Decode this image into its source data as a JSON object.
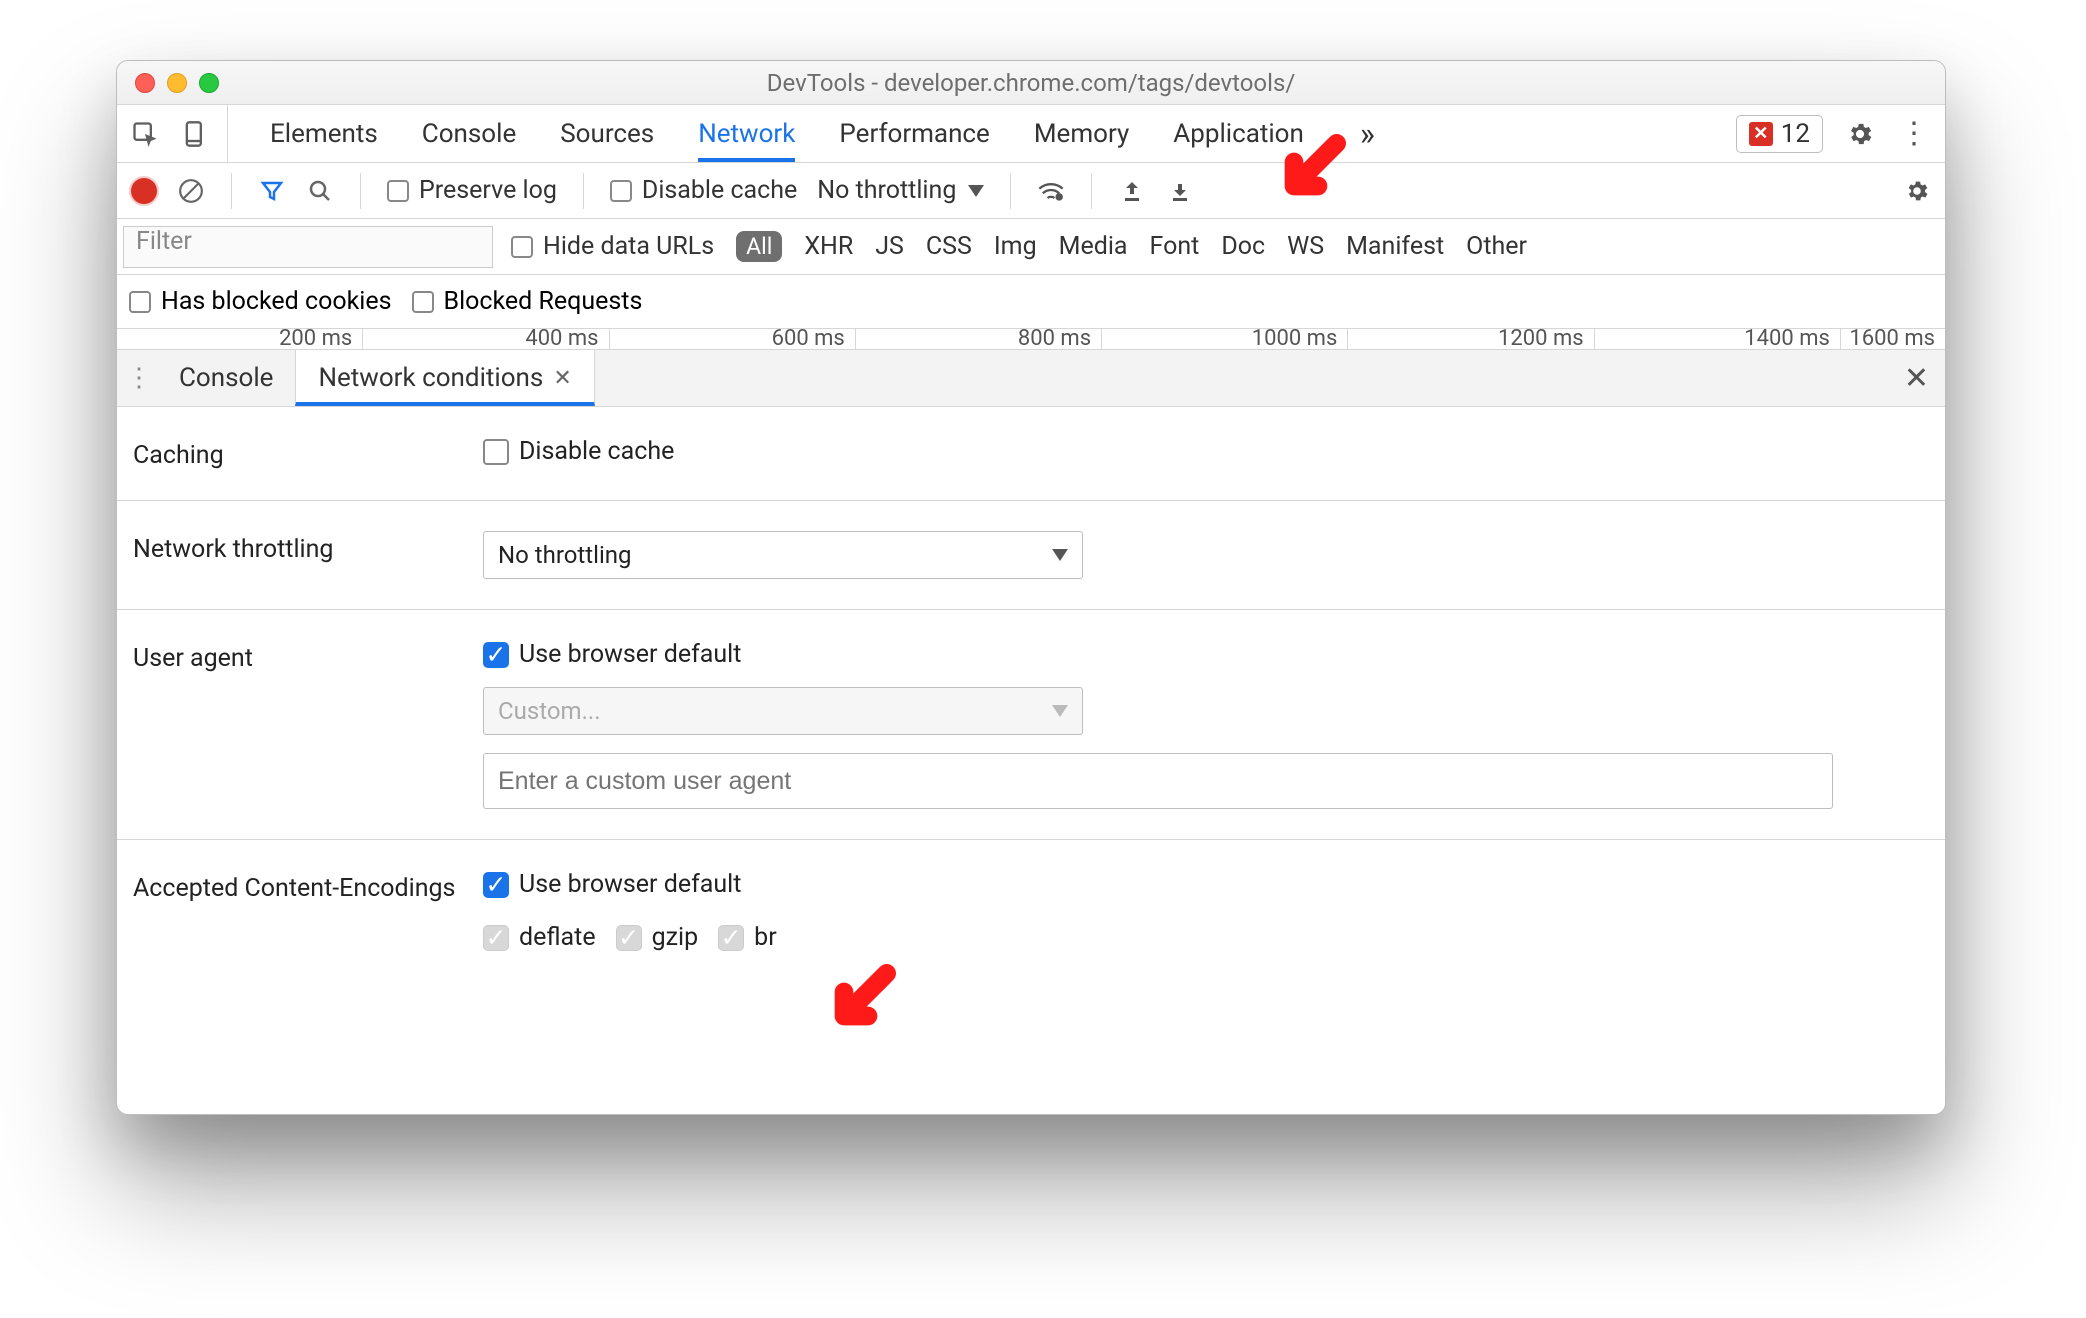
{
  "window": {
    "title": "DevTools - developer.chrome.com/tags/devtools/"
  },
  "tabs": {
    "items": [
      "Elements",
      "Console",
      "Sources",
      "Network",
      "Performance",
      "Memory",
      "Application"
    ],
    "active": "Network",
    "error_count": "12"
  },
  "nettool": {
    "preserve_log": "Preserve log",
    "disable_cache": "Disable cache",
    "throttling": "No throttling"
  },
  "filters": {
    "placeholder": "Filter",
    "hide_data_urls": "Hide data URLs",
    "all": "All",
    "types": [
      "XHR",
      "JS",
      "CSS",
      "Img",
      "Media",
      "Font",
      "Doc",
      "WS",
      "Manifest",
      "Other"
    ],
    "blocked_cookies": "Has blocked cookies",
    "blocked_requests": "Blocked Requests"
  },
  "timeline": [
    "200 ms",
    "400 ms",
    "600 ms",
    "800 ms",
    "1000 ms",
    "1200 ms",
    "1400 ms",
    "1600 ms"
  ],
  "drawer": {
    "tabs": [
      "Console",
      "Network conditions"
    ],
    "active": "Network conditions"
  },
  "conditions": {
    "caching": {
      "label": "Caching",
      "disable_cache": "Disable cache"
    },
    "throttling": {
      "label": "Network throttling",
      "value": "No throttling"
    },
    "ua": {
      "label": "User agent",
      "use_default": "Use browser default",
      "custom": "Custom...",
      "placeholder": "Enter a custom user agent"
    },
    "encodings": {
      "label": "Accepted Content-Encodings",
      "use_default": "Use browser default",
      "opts": [
        "deflate",
        "gzip",
        "br"
      ]
    }
  }
}
